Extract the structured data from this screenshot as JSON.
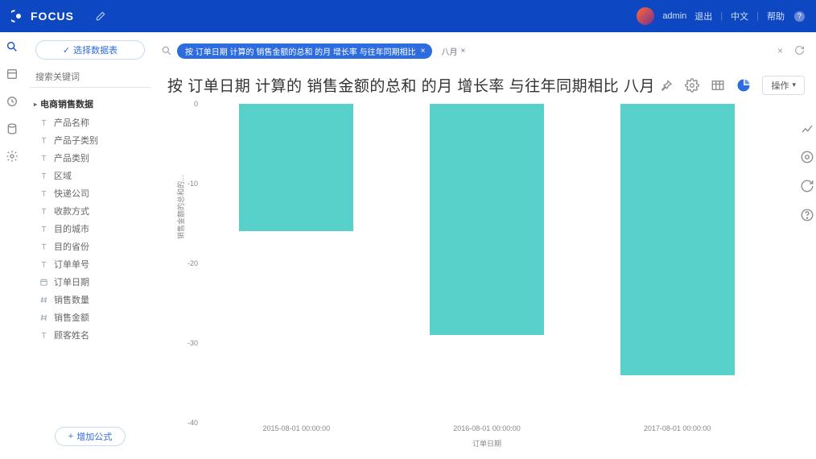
{
  "header": {
    "app_name": "FOCUS",
    "user_name": "admin",
    "logout": "退出",
    "lang": "中文",
    "help": "帮助",
    "help_badge": "?"
  },
  "sidebar": {
    "select_btn": "选择数据表",
    "search_placeholder": "搜索关键词",
    "table_name": "电商销售数据",
    "fields": [
      {
        "icon": "T",
        "label": "产品名称"
      },
      {
        "icon": "T",
        "label": "产品子类别"
      },
      {
        "icon": "T",
        "label": "产品类别"
      },
      {
        "icon": "T",
        "label": "区域"
      },
      {
        "icon": "T",
        "label": "快递公司"
      },
      {
        "icon": "T",
        "label": "收款方式"
      },
      {
        "icon": "T",
        "label": "目的城市"
      },
      {
        "icon": "T",
        "label": "目的省份"
      },
      {
        "icon": "T",
        "label": "订单单号"
      },
      {
        "icon": "D",
        "label": "订单日期"
      },
      {
        "icon": "#",
        "label": "销售数量"
      },
      {
        "icon": "#",
        "label": "销售金额"
      },
      {
        "icon": "T",
        "label": "顾客姓名"
      }
    ],
    "add_formula": "增加公式"
  },
  "query": {
    "pill_text": "按 订单日期 计算的 销售金额的总和 的月 增长率 与往年同期相比",
    "extra_tag": "八月"
  },
  "title": "按 订单日期 计算的 销售金额的总和 的月 增长率 与往年同期相比 八月",
  "ops_label": "操作",
  "chart_data": {
    "type": "bar",
    "title": "",
    "xlabel": "订单日期",
    "ylabel": "销售金额的总和的...",
    "ylim": [
      -40,
      0
    ],
    "y_ticks": [
      0,
      -10,
      -20,
      -30,
      -40
    ],
    "categories": [
      "2015-08-01 00:00:00",
      "2016-08-01 00:00:00",
      "2017-08-01 00:00:00"
    ],
    "values": [
      -16,
      -29,
      -34
    ],
    "series_color": "#57d1c9"
  }
}
